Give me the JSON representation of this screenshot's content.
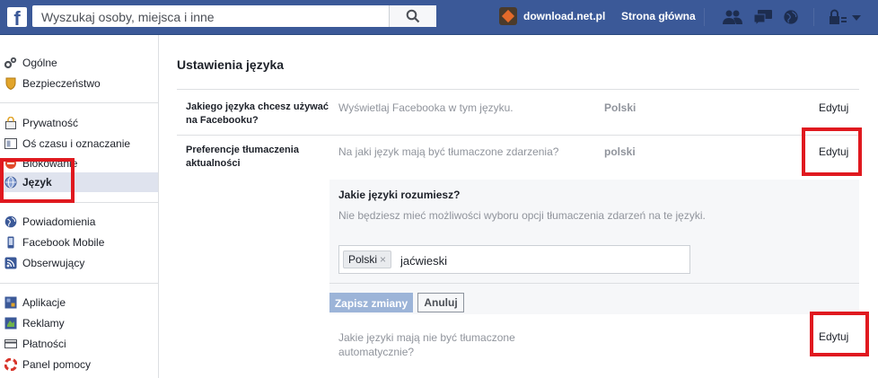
{
  "topbar": {
    "logo": "f",
    "search_placeholder": "Wyszukaj osoby, miejsca i inne",
    "brand_name": "download.net.pl",
    "home_label": "Strona główna",
    "icons": [
      "friends-icon",
      "messages-icon",
      "notifications-globe-icon",
      "privacy-lock-icon",
      "settings-arrow-icon"
    ]
  },
  "sidebar": {
    "items": [
      {
        "label": "Ogólne",
        "icon": "gears-icon"
      },
      {
        "label": "Bezpieczeństwo",
        "icon": "shield-icon"
      },
      {
        "label": "Prywatność",
        "icon": "lock-icon"
      },
      {
        "label": "Oś czasu i oznaczanie",
        "icon": "timeline-icon"
      },
      {
        "label": "Blokowanie",
        "icon": "block-icon"
      },
      {
        "label": "Język",
        "icon": "globe-icon",
        "active": true
      },
      {
        "label": "Powiadomienia",
        "icon": "globe-notify-icon"
      },
      {
        "label": "Facebook Mobile",
        "icon": "mobile-icon"
      },
      {
        "label": "Obserwujący",
        "icon": "rss-icon"
      },
      {
        "label": "Aplikacje",
        "icon": "apps-icon"
      },
      {
        "label": "Reklamy",
        "icon": "ads-icon"
      },
      {
        "label": "Płatności",
        "icon": "card-icon"
      },
      {
        "label": "Panel pomocy",
        "icon": "lifebuoy-icon"
      }
    ]
  },
  "main": {
    "title": "Ustawienia języka",
    "rows": [
      {
        "label": "Jakiego języka chcesz używać na Facebooku?",
        "desc": "Wyświetlaj Facebooka w tym języku.",
        "value": "Polski",
        "edit": "Edytuj"
      },
      {
        "label": "Preferencje tłumaczenia aktualności",
        "desc": "Na jaki język mają być tłumaczone zdarzenia?",
        "value": "polski",
        "edit": "Edytuj"
      }
    ],
    "panel": {
      "question": "Jakie języki rozumiesz?",
      "desc": "Nie będziesz mieć możliwości wyboru opcji tłumaczenia zdarzeń na te języki.",
      "token": "Polski",
      "token_remove": "×",
      "input_value": "jaćwieski",
      "save": "Zapisz zmiany",
      "cancel": "Anuluj"
    },
    "row3": {
      "desc": "Jakie języki mają nie być tłumaczone automatycznie?",
      "edit": "Edytuj"
    }
  },
  "colors": {
    "topbar": "#3b5998",
    "highlight_boxes": "#e0191f"
  }
}
